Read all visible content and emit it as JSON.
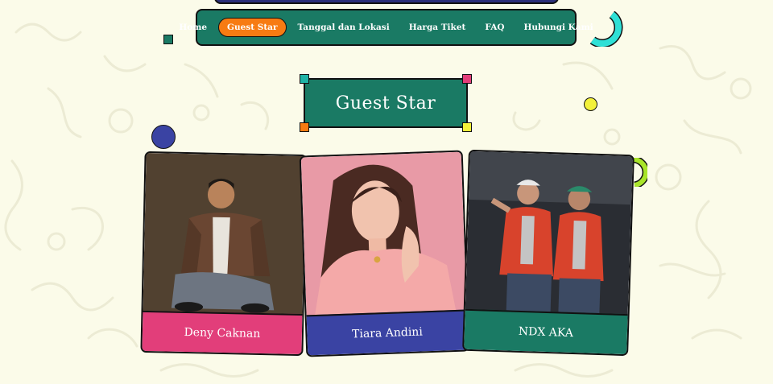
{
  "nav": {
    "items": [
      {
        "label": "Home",
        "active": false
      },
      {
        "label": "Guest Star",
        "active": true
      },
      {
        "label": "Tanggal dan Lokasi",
        "active": false
      },
      {
        "label": "Harga Tiket",
        "active": false
      },
      {
        "label": "FAQ",
        "active": false
      },
      {
        "label": "Hubungi Kami",
        "active": false
      }
    ]
  },
  "section": {
    "title": "Guest Star"
  },
  "guests": [
    {
      "name": "Deny Caknan",
      "color": "#e23e7a"
    },
    {
      "name": "Tiara Andini",
      "color": "#3a43a3"
    },
    {
      "name": "NDX AKA",
      "color": "#1a7a64"
    }
  ],
  "colors": {
    "background": "#fbfbe9",
    "primary_green": "#1a7a64",
    "accent_orange": "#f77b12",
    "navy": "#2b2f7a",
    "cyan": "#2fe0d6",
    "yellow": "#f3f13a",
    "lime": "#a9e52a"
  },
  "icons": {
    "photo_1": "person-photo",
    "photo_2": "person-photo",
    "photo_3": "group-photo"
  }
}
